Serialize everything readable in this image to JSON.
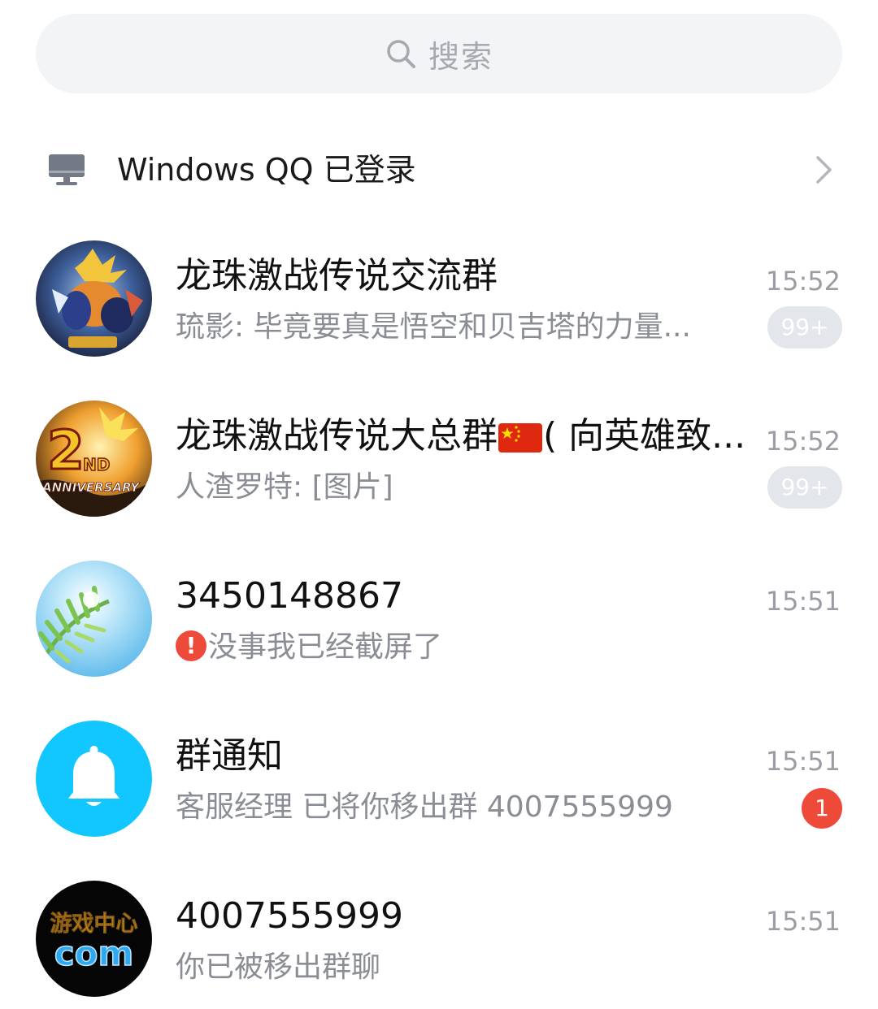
{
  "search": {
    "placeholder": "搜索"
  },
  "login_status": {
    "text": "Windows QQ 已登录"
  },
  "conversations": [
    {
      "name": "龙珠激战传说交流群",
      "preview": "琉影: 毕竟要真是悟空和贝吉塔的力量...",
      "time": "15:52",
      "badge": "99+"
    },
    {
      "name_part1": "龙珠激战传说大总群",
      "name_part2": "( 向英雄致...",
      "preview": "人渣罗特: [图片]",
      "time": "15:52",
      "badge": "99+"
    },
    {
      "name": "3450148867",
      "preview": "没事我已经截屏了",
      "warning_mark": "!",
      "time": "15:51"
    },
    {
      "name": "群通知",
      "preview": "客服经理 已将你移出群 4007555999",
      "time": "15:51",
      "badge": "1"
    },
    {
      "name": "4007555999",
      "preview": "你已被移出群聊",
      "time": "15:51",
      "avatar_text_top": "游戏中心",
      "avatar_text_bottom": "com"
    }
  ],
  "avatar_2_text": {
    "big": "2",
    "sup": "ND",
    "label": "ANNIVERSARY"
  },
  "colors": {
    "badge_grey": "#e3e6ea",
    "badge_red": "#ee4a3a",
    "notify_blue": "#12c7ff",
    "text_primary": "#111111",
    "text_secondary": "#8a8d93"
  }
}
